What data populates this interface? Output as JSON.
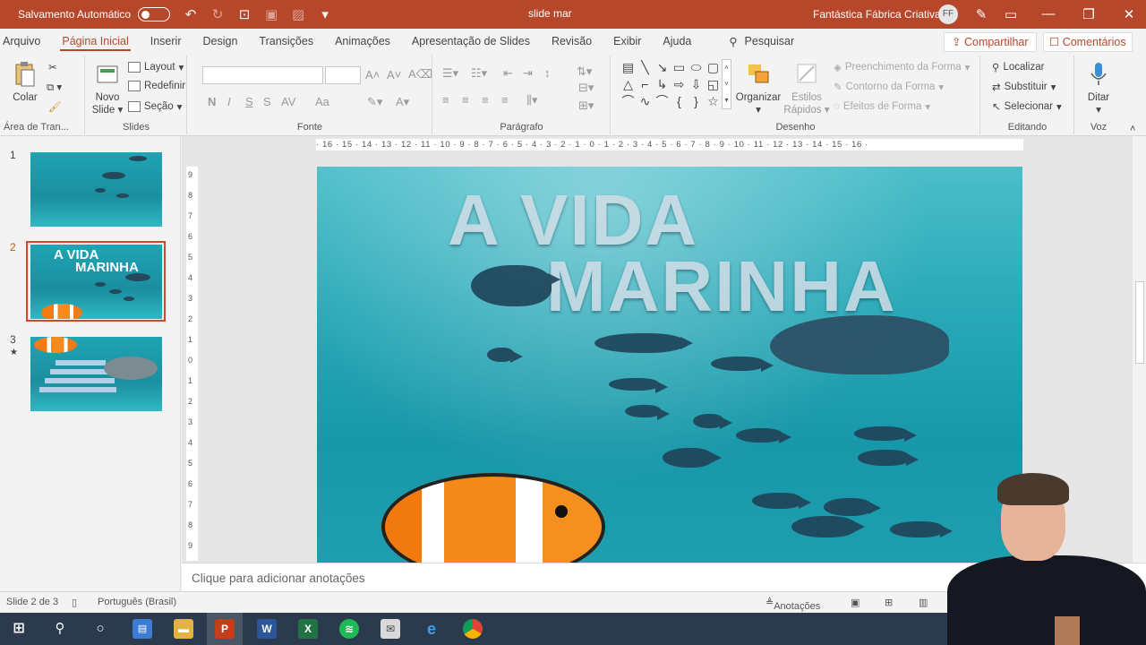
{
  "titlebar": {
    "autosave_label": "Salvamento Automático",
    "doc_title": "slide mar",
    "user_name": "Fantástica Fábrica Criativa",
    "user_initials": "FF"
  },
  "menu": {
    "tabs": [
      "Arquivo",
      "Página Inicial",
      "Inserir",
      "Design",
      "Transições",
      "Animações",
      "Apresentação de Slides",
      "Revisão",
      "Exibir",
      "Ajuda"
    ],
    "active_tab": "Página Inicial",
    "search_label": "Pesquisar",
    "share_label": "Compartilhar",
    "comments_label": "Comentários"
  },
  "ribbon": {
    "clipboard": {
      "label": "Área de Tran...",
      "paste_label": "Colar"
    },
    "slides": {
      "label": "Slides",
      "new_slide_line1": "Novo",
      "new_slide_line2": "Slide",
      "layout": "Layout",
      "reset": "Redefinir",
      "section": "Seção"
    },
    "font": {
      "label": "Fonte",
      "format_buttons": [
        "N",
        "I",
        "S",
        "S",
        "AV",
        "Aa"
      ]
    },
    "paragraph": {
      "label": "Parágrafo"
    },
    "drawing": {
      "label": "Desenho",
      "arrange": "Organizar",
      "quick_styles_line1": "Estilos",
      "quick_styles_line2": "Rápidos",
      "shape_fill": "Preenchimento da Forma",
      "shape_outline": "Contorno da Forma",
      "shape_effects": "Efeitos de Forma"
    },
    "editing": {
      "label": "Editando",
      "find": "Localizar",
      "replace": "Substituir",
      "select": "Selecionar"
    },
    "voice": {
      "label": "Voz",
      "dictate": "Ditar"
    }
  },
  "slides_panel": {
    "thumbnails": [
      {
        "number": "1"
      },
      {
        "number": "2",
        "title_line1": "A VIDA",
        "title_line2": "MARINHA"
      },
      {
        "number": "3",
        "marker": "★"
      }
    ],
    "active_index": 2
  },
  "slide": {
    "title_line1": "A VIDA",
    "title_line2": "MARINHA"
  },
  "ruler": {
    "horizontal": "· 16 · 15 · 14 · 13 · 12 · 11 · 10 · 9 · 8 · 7 · 6 · 5 · 4 · 3 · 2 · 1 · 0 · 1 · 2 · 3 · 4 · 5 · 6 · 7 · 8 · 9 · 10 · 11 · 12 · 13 · 14 · 15 · 16 ·",
    "vertical": [
      "9",
      "8",
      "7",
      "6",
      "5",
      "4",
      "3",
      "2",
      "1",
      "0",
      "1",
      "2",
      "3",
      "4",
      "5",
      "6",
      "7",
      "8",
      "9"
    ]
  },
  "notes": {
    "placeholder": "Clique para adicionar anotações"
  },
  "statusbar": {
    "slide_indicator": "Slide 2 de 3",
    "language": "Português (Brasil)",
    "notes_label": "Anotações"
  },
  "colors": {
    "accent": "#b7472a",
    "taskbar": "#2b3a4d",
    "ribbon_bg": "#f3f3f3"
  }
}
